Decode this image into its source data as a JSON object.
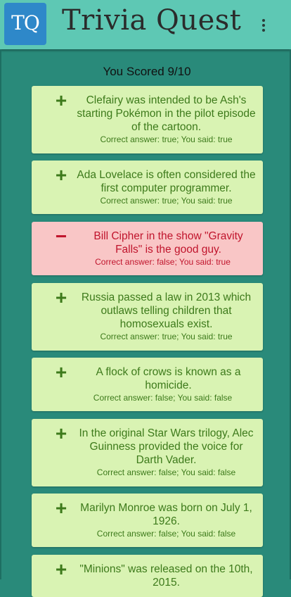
{
  "app": {
    "logo_text": "TQ",
    "title": "Trivia Quest",
    "menu_icon": "more-vert-icon"
  },
  "score_text": "You Scored 9/10",
  "colors": {
    "appbar": "#5ec8b4",
    "background": "#298a7a",
    "correct_bg": "#d9f3b3",
    "correct_text": "#3d7a1b",
    "wrong_bg": "#f9c6c6",
    "wrong_text": "#c0142c",
    "logo_bg": "#2e88c9"
  },
  "results": [
    {
      "correct": true,
      "mark": "+",
      "question": "Clefairy was intended to be Ash's starting Pokémon in the pilot episode of the cartoon.",
      "answer": "Correct answer: true; You said: true"
    },
    {
      "correct": true,
      "mark": "+",
      "question": "Ada Lovelace is often considered the first computer programmer.",
      "answer": "Correct answer: true; You said: true"
    },
    {
      "correct": false,
      "mark": "−",
      "question": "Bill Cipher in the show \"Gravity Falls\" is the good guy.",
      "answer": "Correct answer: false; You said: true"
    },
    {
      "correct": true,
      "mark": "+",
      "question": "Russia passed a law in 2013 which outlaws telling children that homosexuals exist.",
      "answer": "Correct answer: true; You said: true"
    },
    {
      "correct": true,
      "mark": "+",
      "question": "A flock of crows is known as a homicide.",
      "answer": "Correct answer: false; You said: false"
    },
    {
      "correct": true,
      "mark": "+",
      "question": "In the original Star Wars trilogy, Alec Guinness provided the voice for Darth Vader.",
      "answer": "Correct answer: false; You said: false"
    },
    {
      "correct": true,
      "mark": "+",
      "question": "Marilyn Monroe was born on July 1, 1926.",
      "answer": "Correct answer: false; You said: false"
    },
    {
      "correct": true,
      "mark": "+",
      "question": "\"Minions\" was released on the 10th, 2015.",
      "answer": ""
    }
  ]
}
